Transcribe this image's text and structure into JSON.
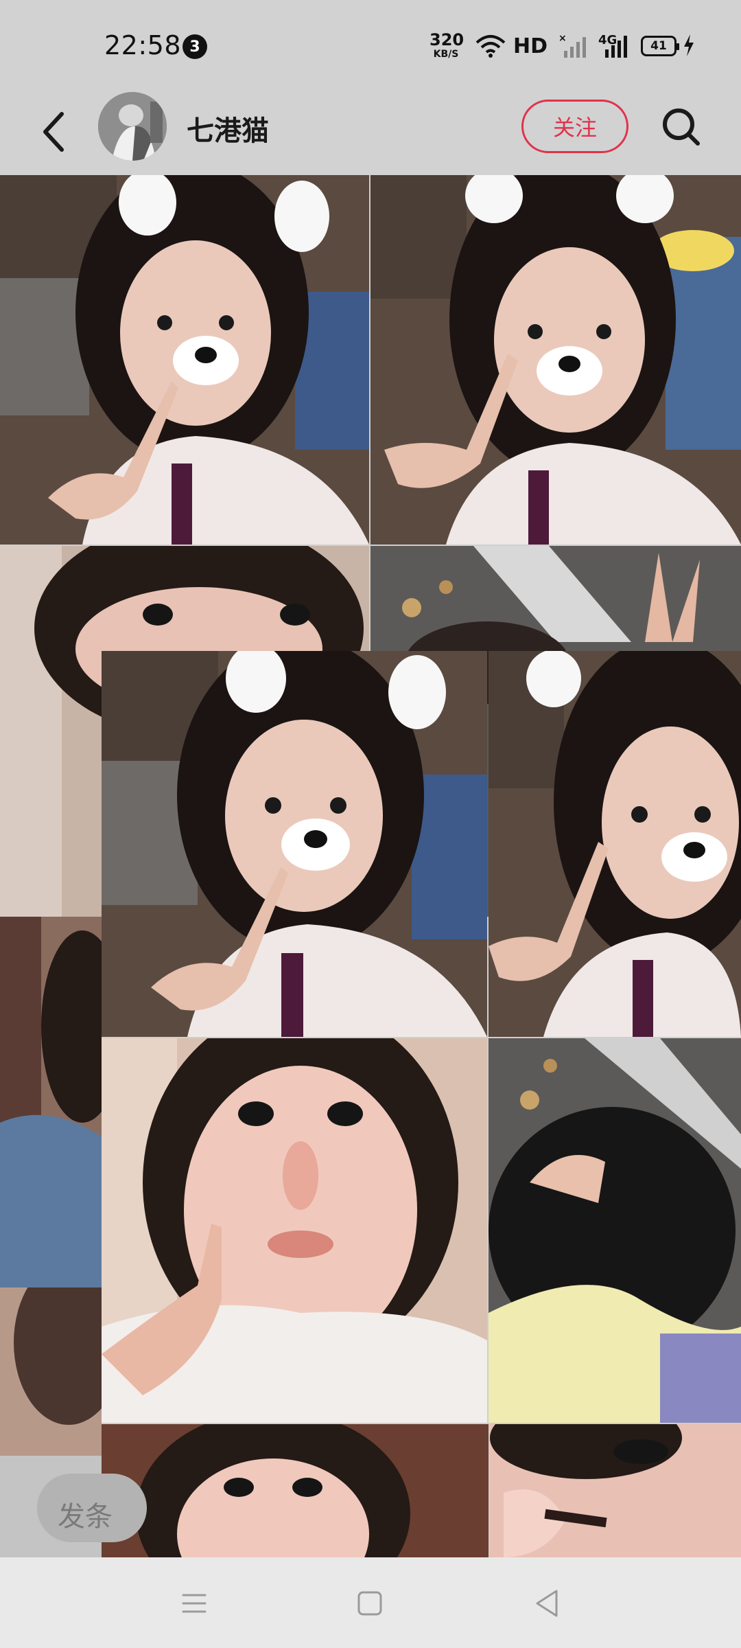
{
  "status_bar": {
    "time": "22:58",
    "notification_count": "3",
    "net_speed_value": "320",
    "net_speed_unit": "KB/S",
    "hd_label": "HD",
    "lte_label": "4G",
    "battery_level": "41",
    "icons": [
      "wifi-icon",
      "signal-icon-1",
      "signal-icon-2",
      "charging-icon"
    ]
  },
  "header": {
    "back_icon": "chevron-left-icon",
    "username": "七港猫",
    "follow_label": "关注",
    "search_icon": "search-icon",
    "accent_color": "#e0324b"
  },
  "photos": [
    {
      "name": "photo-tile-1",
      "description_icon": "photo"
    },
    {
      "name": "photo-tile-2",
      "description_icon": "photo"
    },
    {
      "name": "photo-tile-3",
      "description_icon": "photo"
    },
    {
      "name": "photo-tile-4",
      "description_icon": "photo"
    },
    {
      "name": "photo-tile-5",
      "description_icon": "photo"
    },
    {
      "name": "photo-tile-6",
      "description_icon": "photo"
    },
    {
      "name": "photo-tile-7",
      "description_icon": "photo"
    },
    {
      "name": "photo-tile-8",
      "description_icon": "photo"
    },
    {
      "name": "photo-tile-9",
      "description_icon": "photo"
    },
    {
      "name": "photo-tile-10",
      "description_icon": "photo"
    },
    {
      "name": "photo-tile-11",
      "description_icon": "photo"
    }
  ],
  "comment": {
    "placeholder_partial": "发条"
  },
  "nav_bar": {
    "icons": [
      "menu-icon",
      "home-icon",
      "back-triangle-icon"
    ]
  }
}
